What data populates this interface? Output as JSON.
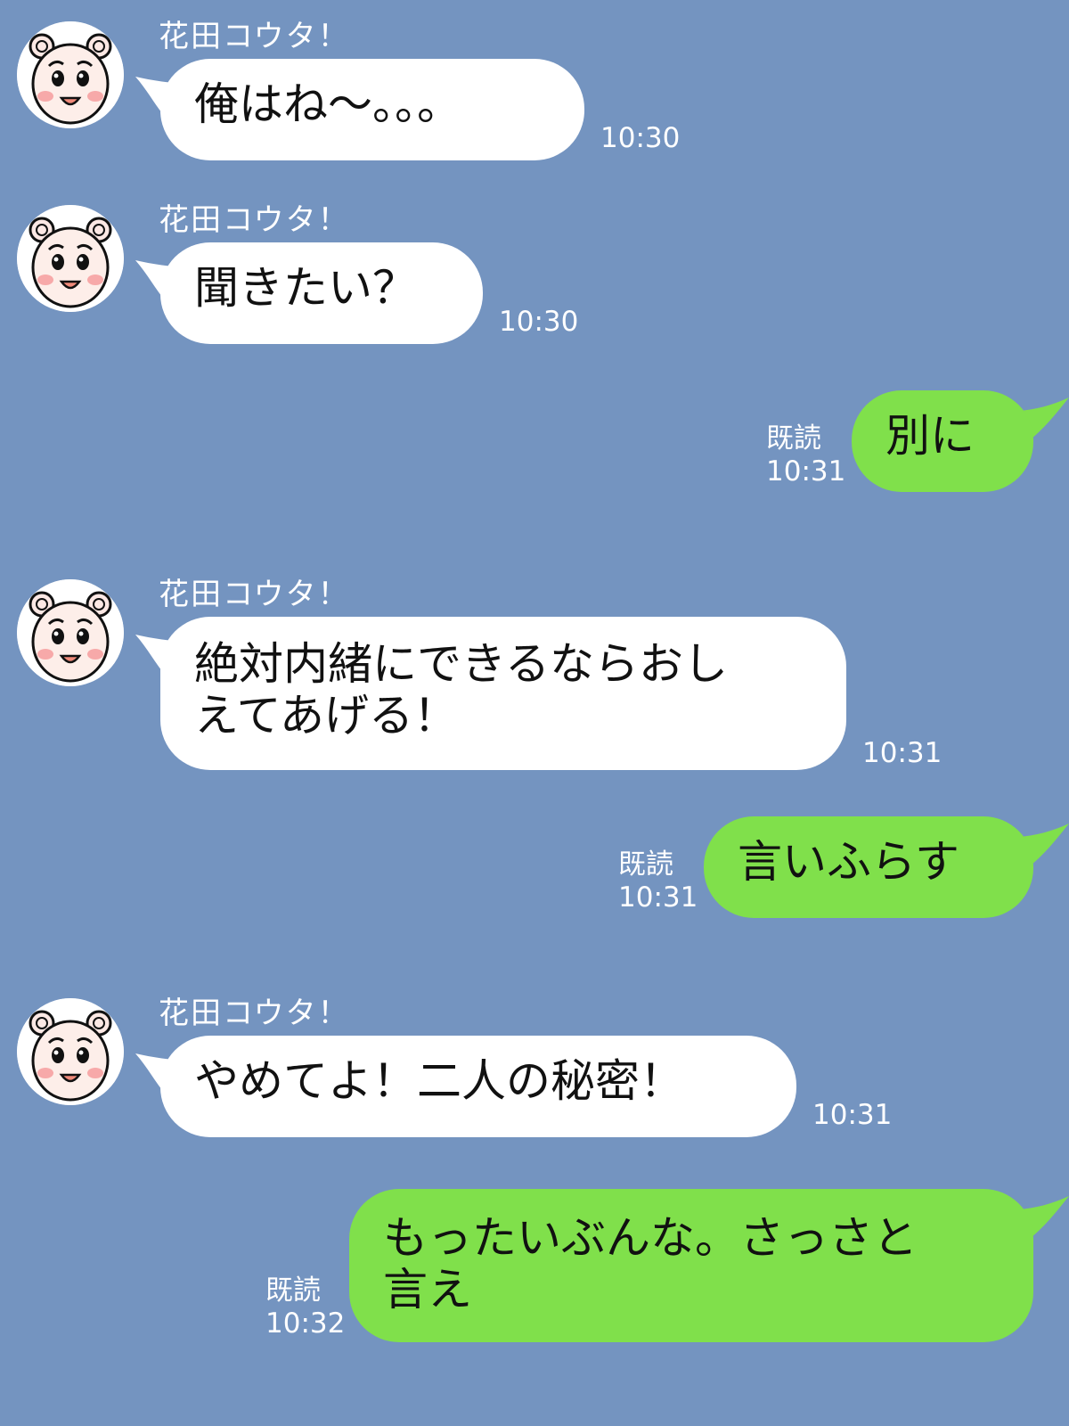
{
  "colors": {
    "background": "#7494c0",
    "incoming_bubble": "#ffffff",
    "outgoing_bubble": "#80e04b",
    "meta_text": "#ffffff"
  },
  "messages": [
    {
      "direction": "in",
      "sender": "花田コウタ！",
      "text": "俺はね〜。。。",
      "time": "10:30",
      "avatar": "bear-avatar-icon"
    },
    {
      "direction": "in",
      "sender": "花田コウタ！",
      "text": "聞きたい？",
      "time": "10:30",
      "avatar": "bear-avatar-icon"
    },
    {
      "direction": "out",
      "text": "別に",
      "read": "既読",
      "time": "10:31"
    },
    {
      "direction": "in",
      "sender": "花田コウタ！",
      "text": "絶対内緒にできるならおし\nえてあげる！",
      "time": "10:31",
      "avatar": "bear-avatar-icon"
    },
    {
      "direction": "out",
      "text": "言いふらす",
      "read": "既読",
      "time": "10:31"
    },
    {
      "direction": "in",
      "sender": "花田コウタ！",
      "text": "やめてよ！二人の秘密！",
      "time": "10:31",
      "avatar": "bear-avatar-icon"
    },
    {
      "direction": "out",
      "text": "もったいぶんな。さっさと\n言え",
      "read": "既読",
      "time": "10:32"
    }
  ]
}
